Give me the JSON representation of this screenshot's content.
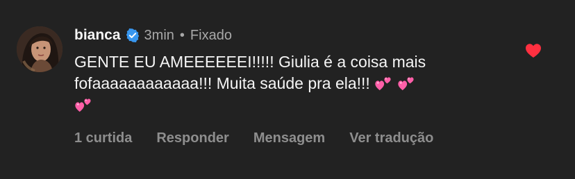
{
  "comment": {
    "username": "bianca",
    "verified_icon": "verified-badge-icon",
    "timestamp": "3min",
    "separator": "•",
    "pinned_label": "Fixado",
    "text_lines": [
      "GENTE EU AMEEEEEEI!!!!! Giulia é a coisa mais",
      "fofaaaaaaaaaaaa!!! Muita saúde pra ela!!!"
    ],
    "emoji_icon": "two-hearts-emoji",
    "like_icon": "heart-filled-icon",
    "actions": {
      "likes": "1 curtida",
      "reply": "Responder",
      "message": "Mensagem",
      "translate": "Ver tradução"
    }
  },
  "colors": {
    "background": "#222222",
    "text": "#f5f5f5",
    "secondary_text": "#a8a8a8",
    "action_text": "#8e8e8e",
    "verified_blue": "#3897f0",
    "like_red": "#ff3040",
    "emoji_pink": "#ff5fa8"
  }
}
